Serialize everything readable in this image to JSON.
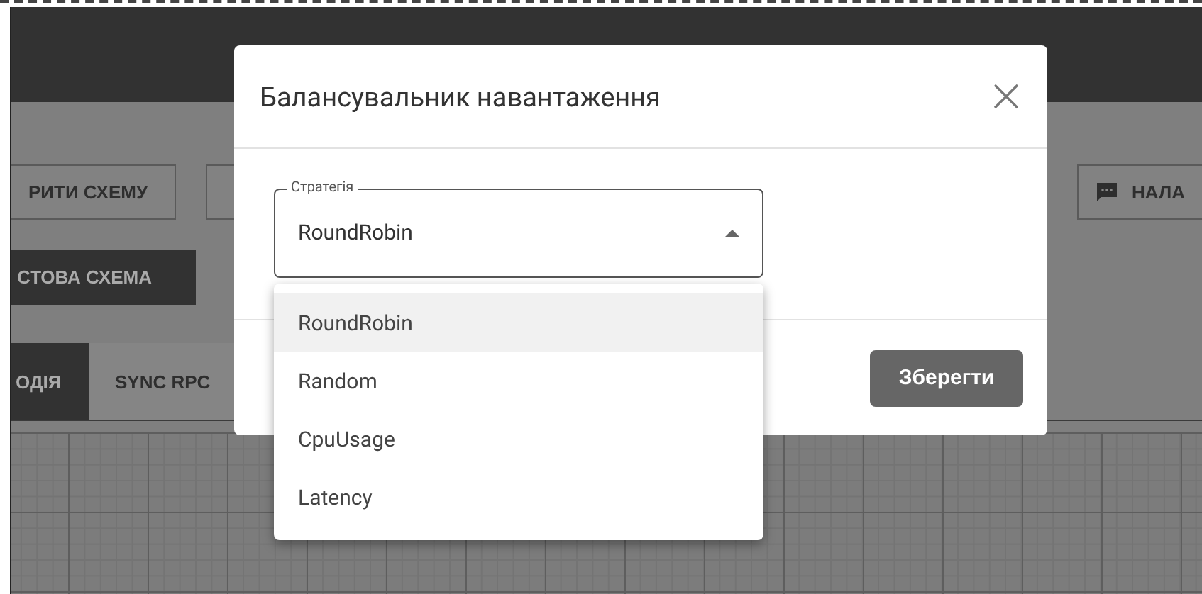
{
  "background": {
    "toolbar_buttons": [
      {
        "label": "РИТИ СХЕМУ",
        "kind": "outlined"
      },
      {
        "kind": "partial"
      },
      {
        "label": "НАЛА",
        "kind": "chat"
      }
    ],
    "primary_button": "СТОВА СХЕМА",
    "tabs": [
      {
        "label": "ОДІЯ",
        "selected": true
      },
      {
        "label": "SYNC RPC",
        "selected": false
      }
    ]
  },
  "dialog": {
    "title": "Балансувальник навантаження",
    "field": {
      "label": "Стратегія",
      "value": "RoundRobin",
      "expanded": true
    },
    "options": [
      {
        "label": "RoundRobin",
        "selected": true
      },
      {
        "label": "Random",
        "selected": false
      },
      {
        "label": "CpuUsage",
        "selected": false
      },
      {
        "label": "Latency",
        "selected": false
      }
    ],
    "save_button": "Зберегти"
  }
}
